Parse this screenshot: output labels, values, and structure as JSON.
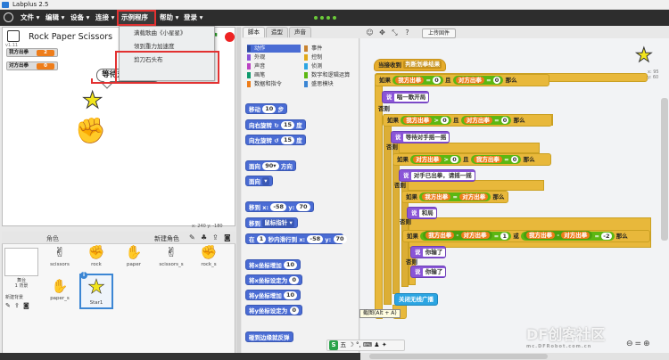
{
  "titlebar": {
    "title": "Labplus 2.5"
  },
  "menubar": {
    "items": [
      "文件 ▾",
      "编辑 ▾",
      "设备 ▾",
      "连接 ▾",
      "示例程序 ▾",
      "帮助 ▾",
      "登录 ▾"
    ],
    "selected_index": 4
  },
  "dropdown": {
    "items": [
      "满载歌曲《小星星》",
      "领到重力加速度",
      "剪刀石头布"
    ],
    "highlight_index": 2
  },
  "stage": {
    "title": "Rock Paper Scissors",
    "version": "v1.11",
    "variables": [
      {
        "label": "我方出拳",
        "value": "2"
      },
      {
        "label": "对方出拳",
        "value": "0"
      }
    ],
    "speech_bubble": "等待对手摇一摇",
    "coords": "x: 240  y: -180"
  },
  "sprite_panel": {
    "header": "角色",
    "new_sprite_label": "新建角色",
    "stage_caption": "舞台\n1 背景",
    "new_backdrop_label": "新建背景",
    "sprites": [
      {
        "name": "scissors",
        "icon": "scissors-hand"
      },
      {
        "name": "rock",
        "icon": "fist"
      },
      {
        "name": "paper",
        "icon": "open-hand"
      },
      {
        "name": "scissors_s",
        "icon": "scissors-hand"
      },
      {
        "name": "rock_s",
        "icon": "fist"
      },
      {
        "name": "paper_s",
        "icon": "open-hand"
      },
      {
        "name": "Star1",
        "icon": "star"
      }
    ],
    "selected_sprite": "Star1"
  },
  "tabs": [
    "脚本",
    "造型",
    "声音"
  ],
  "selected_tab": "脚本",
  "categories": [
    {
      "label": "动作",
      "color": "#4a6cd4"
    },
    {
      "label": "事件",
      "color": "#c88330"
    },
    {
      "label": "外观",
      "color": "#8a55d7"
    },
    {
      "label": "控制",
      "color": "#e1a91a"
    },
    {
      "label": "声音",
      "color": "#bb42c3"
    },
    {
      "label": "侦测",
      "color": "#2ca5e2"
    },
    {
      "label": "画笔",
      "color": "#0e9a6c"
    },
    {
      "label": "数字和逻辑运算",
      "color": "#5cb712"
    },
    {
      "label": "数据和指令",
      "color": "#ee7d1a"
    },
    {
      "label": "盛思模块",
      "color": "#3b86d4"
    }
  ],
  "palette_blocks": {
    "move": {
      "label": "移动",
      "value": "10",
      "suffix": "步"
    },
    "turn_right": {
      "label": "向右旋转 ↻",
      "value": "15",
      "suffix": "度"
    },
    "turn_left": {
      "label": "向左旋转 ↺",
      "value": "15",
      "suffix": "度"
    },
    "point_dir": {
      "label": "面向",
      "value": "90▾",
      "suffix": "方向"
    },
    "point_to": {
      "label": "面向",
      "value": "▾"
    },
    "goto_xy": {
      "label": "移到 x:",
      "x": "-58",
      "ylabel": "y:",
      "y": "70"
    },
    "goto_mouse": {
      "label": "移到",
      "value": "鼠标指针 ▾"
    },
    "glide": {
      "label": "在",
      "value": "1",
      "mid": "秒内滑行到 x:",
      "x": "-58",
      "ylabel": "y:",
      "y": "70"
    },
    "change_x": {
      "label": "将x坐标增加",
      "value": "10"
    },
    "set_x": {
      "label": "将x坐标设定为",
      "value": "0"
    },
    "change_y": {
      "label": "将y坐标增加",
      "value": "10"
    },
    "set_y": {
      "label": "将y坐标设定为",
      "value": "0"
    },
    "bounce": {
      "label": "碰到边缘就反弹"
    }
  },
  "script": {
    "hat": {
      "label": "当接收到",
      "value": "判断划拳结果"
    },
    "if1": {
      "kw": "如果",
      "a": "我方出拳",
      "op": "=",
      "b": "0",
      "and": "且",
      "c": "对方出拳",
      "op2": "=",
      "d": "0",
      "then": "那么"
    },
    "say1": {
      "label": "说",
      "text": "唱一歌开局"
    },
    "else1": "否则",
    "if2": {
      "kw": "如果",
      "a": "我方出拳",
      "op": ">",
      "b": "0",
      "and": "且",
      "c": "对方出拳",
      "op2": "=",
      "d": "0",
      "then": "那么"
    },
    "say2": {
      "label": "说",
      "text": "等待对手摇一摇"
    },
    "else2": "否则",
    "if3": {
      "kw": "如果",
      "a": "对方出拳",
      "op": ">",
      "b": "0",
      "and": "且",
      "c": "我方出拳",
      "op2": "=",
      "d": "0",
      "then": "那么"
    },
    "say3": {
      "label": "说",
      "text": "对手已出拳，请摇一摇"
    },
    "else3": "否则",
    "if4": {
      "kw": "如果",
      "a": "我方出拳",
      "op": "=",
      "c": "对方出拳",
      "then": "那么"
    },
    "say4": {
      "label": "说",
      "text": "和局"
    },
    "else4": "否则",
    "if5": {
      "kw": "如果",
      "a": "我方出拳",
      "op": "-",
      "c": "对方出拳",
      "op2": "=",
      "d": "1",
      "or": "或",
      "e": "我方出拳",
      "op3": "-",
      "f": "对方出拳",
      "op4": "=",
      "g": "-2",
      "then": "那么"
    },
    "say5": {
      "label": "说",
      "text": "你输了"
    },
    "else5": "否则",
    "say6": {
      "label": "说",
      "text": "你输了"
    },
    "broadcast": {
      "label": "关闭无线广播"
    }
  },
  "toolbar": {
    "upload_label": "上传固件",
    "tools": [
      "person-icon",
      "expand-icon",
      "shrink-icon",
      "help-icon"
    ]
  },
  "sprite_info": {
    "xy": "x: 95\ny: 60"
  },
  "tooltip": "截图(Alt + A)",
  "ime": {
    "label": "五"
  },
  "watermark": {
    "main": "DF创客社区",
    "sub": "mc.DFRobot.com.cn"
  }
}
